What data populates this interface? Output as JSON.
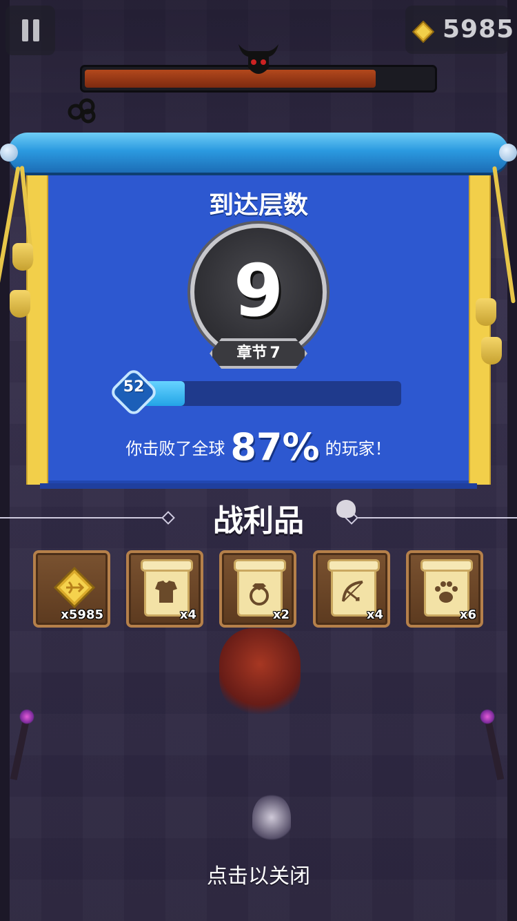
{
  "hud": {
    "gem_icon": "gem-icon",
    "gem_count": "5985",
    "boss_health_percent": 84,
    "pause_icon": "pause-icon"
  },
  "result": {
    "title": "到达层数",
    "floor": "9",
    "chapter_label": "章节",
    "chapter_number": "7",
    "player_level": "52",
    "xp_percent": 20,
    "defeat_prefix": "你击败了全球",
    "defeat_percent": "87%",
    "defeat_suffix": "的玩家！"
  },
  "loot": {
    "title": "战利品",
    "items": [
      {
        "icon": "gem-bow-icon",
        "qty": "x5985"
      },
      {
        "icon": "armor-scroll-icon",
        "qty": "x4"
      },
      {
        "icon": "ring-scroll-icon",
        "qty": "x2"
      },
      {
        "icon": "bow-scroll-icon",
        "qty": "x4"
      },
      {
        "icon": "paw-scroll-icon",
        "qty": "x6"
      }
    ]
  },
  "footer": {
    "close_hint": "点击以关闭"
  },
  "colors": {
    "panel_blue": "#2d58d0",
    "gold_trim": "#f2cf4a",
    "xp_blue": "#23a4e6",
    "boss_bar": "#b3481c"
  }
}
